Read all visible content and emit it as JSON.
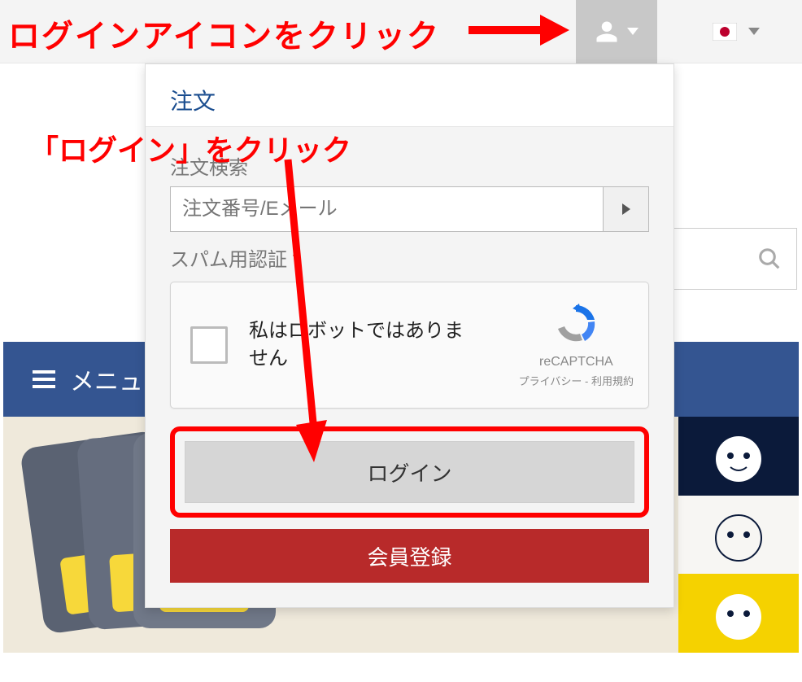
{
  "instructions": {
    "click_login_icon": "ログインアイコンをクリック",
    "click_login": "「ログイン」をクリック"
  },
  "topbar": {
    "user_icon": "user-icon",
    "flag": "japan-flag-icon"
  },
  "dropdown": {
    "header_link": "注文",
    "order_search_label": "注文検索",
    "order_input_placeholder": "注文番号/Eメール",
    "spam_label": "スパム用認証",
    "required_mark": "*",
    "recaptcha_text": "私はロボットではありません",
    "recaptcha_brand": "reCAPTCHA",
    "recaptcha_privacy": "プライバシー",
    "recaptcha_sep": " - ",
    "recaptcha_terms": "利用規約",
    "login_button": "ログイン",
    "register_button": "会員登録"
  },
  "nav": {
    "menu_label": "メニュ"
  }
}
